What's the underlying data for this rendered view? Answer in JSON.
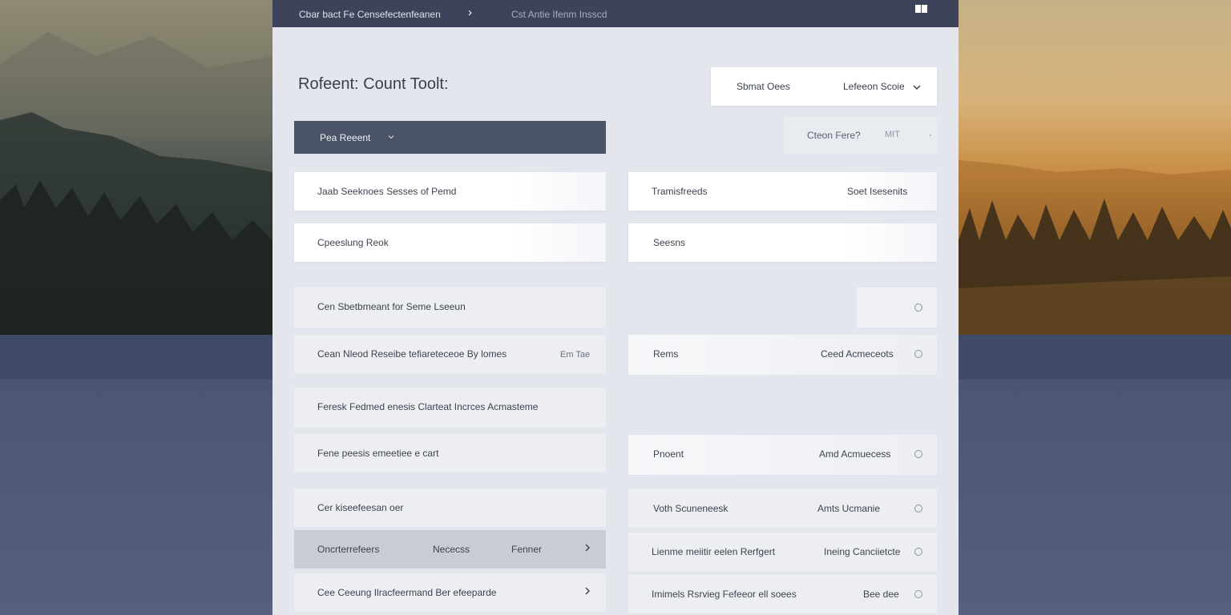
{
  "topbar": {
    "breadcrumb_primary": "Cbar bact Fe Censefectenfeanen",
    "breadcrumb_secondary": "Cst Antie Ifenm Insscd"
  },
  "main": {
    "title": "Rofeent: Count Toolt:",
    "sort": {
      "label": "Sbmat Oees",
      "value": "Lefeeon Scoie"
    },
    "filter_select": {
      "label": "Pea Reeent"
    },
    "ghost_field": {
      "label": "Cteon Fere?",
      "value": "MIT"
    }
  },
  "cards_left": [
    {
      "label": "Jaab Seeknoes Sesses of Pemd"
    },
    {
      "label": "Cpeeslung Reok"
    },
    {
      "label": "Cen Sbetbmeant for Seme Lseeun"
    },
    {
      "label": "Cean Nleod Reseibe tefiareteceoe By lomes",
      "meta": "Em Tae"
    },
    {
      "label": "Feresk Fedmed enesis Clarteat Incrces Acmasteme"
    },
    {
      "label": "Fene peesis emeetiee e cart"
    },
    {
      "label": "Cer kiseefeesan oer"
    },
    {
      "label": "Oncrterrefeers",
      "col2": "Nececss",
      "col3": "Fenner"
    },
    {
      "label": "Cee Ceeung Ilracfeermand Ber efeeparde"
    }
  ],
  "cards_right": [
    {
      "label": "Tramisfreeds",
      "value": "Soet Isesenits"
    },
    {
      "label": "Seesns"
    },
    {
      "label": "Rems",
      "value": "Ceed Acmeceots"
    },
    {
      "label": "Pnoent",
      "value": "Amd Acmuecess"
    },
    {
      "label": "Voth Scuneneesk",
      "value": "Amts Ucmanie"
    },
    {
      "label": "Lienme meiitir eelen Rerfgert",
      "value": "Ineing Canciietcte"
    },
    {
      "label": "Imimels Rsrvieg Fefeeor ell soees",
      "value": "Bee dee"
    }
  ],
  "colors": {
    "topbar": "#3d4459",
    "panel": "#e3e6ec",
    "dark_select": "#4b5366",
    "card": "#ffffff",
    "selected_card": "#c9ccd4"
  },
  "icons": [
    "chevron-right-icon",
    "window-toggle-icon",
    "chevron-down-icon",
    "radio-icon"
  ]
}
